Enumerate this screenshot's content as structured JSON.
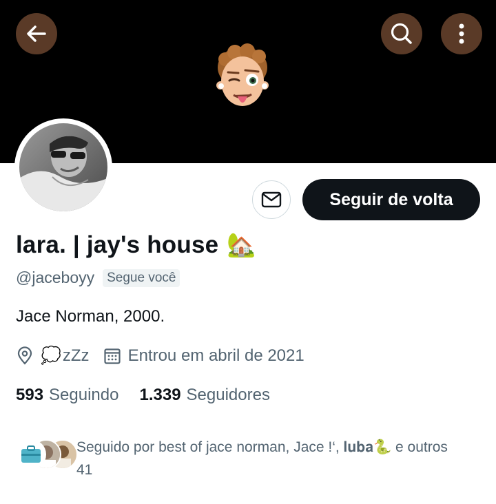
{
  "header": {
    "back_icon": "arrow-left-icon",
    "search_icon": "search-icon",
    "more_icon": "more-vertical-icon",
    "button_bg": "#5a3a27",
    "banner_color": "#000000"
  },
  "profile": {
    "display_name": "lara. | jay's house",
    "name_emoji": "🏡",
    "handle": "@jaceboyy",
    "follows_you": "Segue você",
    "bio": "Jace Norman, 2000.",
    "location_emoji": "💭",
    "location": "zZz",
    "joined": "Entrou em abril de 2021",
    "following_count": "593",
    "following_label": "Seguindo",
    "followers_count": "1.339",
    "followers_label": "Seguidores",
    "followed_by_prefix": "Seguido por best of jace norman, Jace !‘, 𝐥𝐮𝐛𝐚",
    "followed_by_emoji": "🐍",
    "followed_by_suffix": " e outros 41"
  },
  "actions": {
    "message_icon": "mail-icon",
    "follow_back_label": "Seguir de volta"
  },
  "colors": {
    "text_primary": "#0f1419",
    "text_secondary": "#536471",
    "button_dark": "#0f1419"
  }
}
